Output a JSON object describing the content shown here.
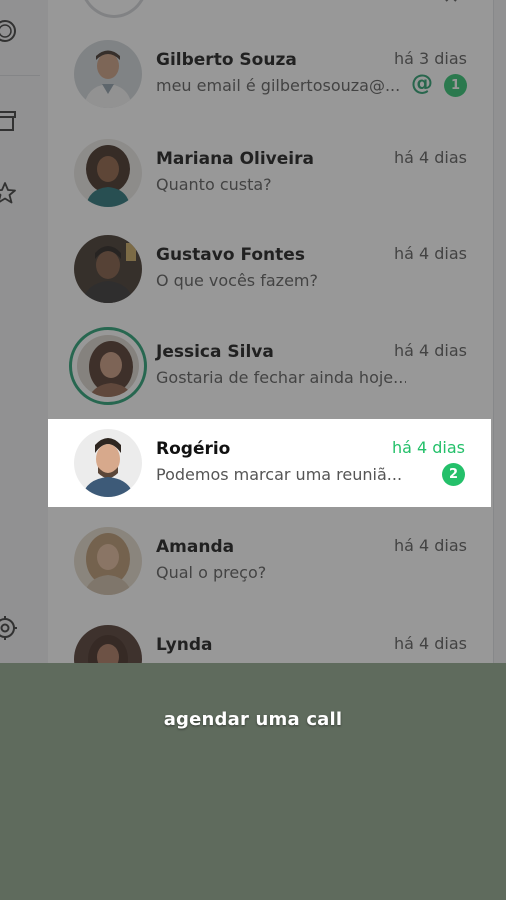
{
  "conversations": [
    {
      "name": "Gilberto Souza",
      "preview": "meu email é gilbertosouza@...",
      "time": "há 3 dias",
      "badge": "1",
      "mention": "@"
    },
    {
      "name": "Mariana Oliveira",
      "preview": "Quanto custa?",
      "time": "há 4 dias"
    },
    {
      "name": "Gustavo Fontes",
      "preview": "O que vocês fazem?",
      "time": "há 4 dias"
    },
    {
      "name": "Jessica Silva",
      "preview": "Gostaria de fechar ainda hoje...",
      "time": "há 4 dias"
    },
    {
      "name": "Rogério",
      "preview": "Podemos marcar uma reuniã...",
      "time": "há 4 dias",
      "badge": "2"
    },
    {
      "name": "Amanda",
      "preview": "Qual o preço?",
      "time": "há 4 dias"
    },
    {
      "name": "Lynda",
      "preview": "",
      "time": "há 4 dias"
    }
  ],
  "caption": "agendar uma call",
  "icons": [
    "status-icon",
    "archive-icon",
    "star-icon",
    "settings-icon",
    "close-icon"
  ],
  "colors": {
    "accent": "#24c06a",
    "accent_dark": "#1d9c6e",
    "overlay_bg": "#5f6b5d"
  }
}
